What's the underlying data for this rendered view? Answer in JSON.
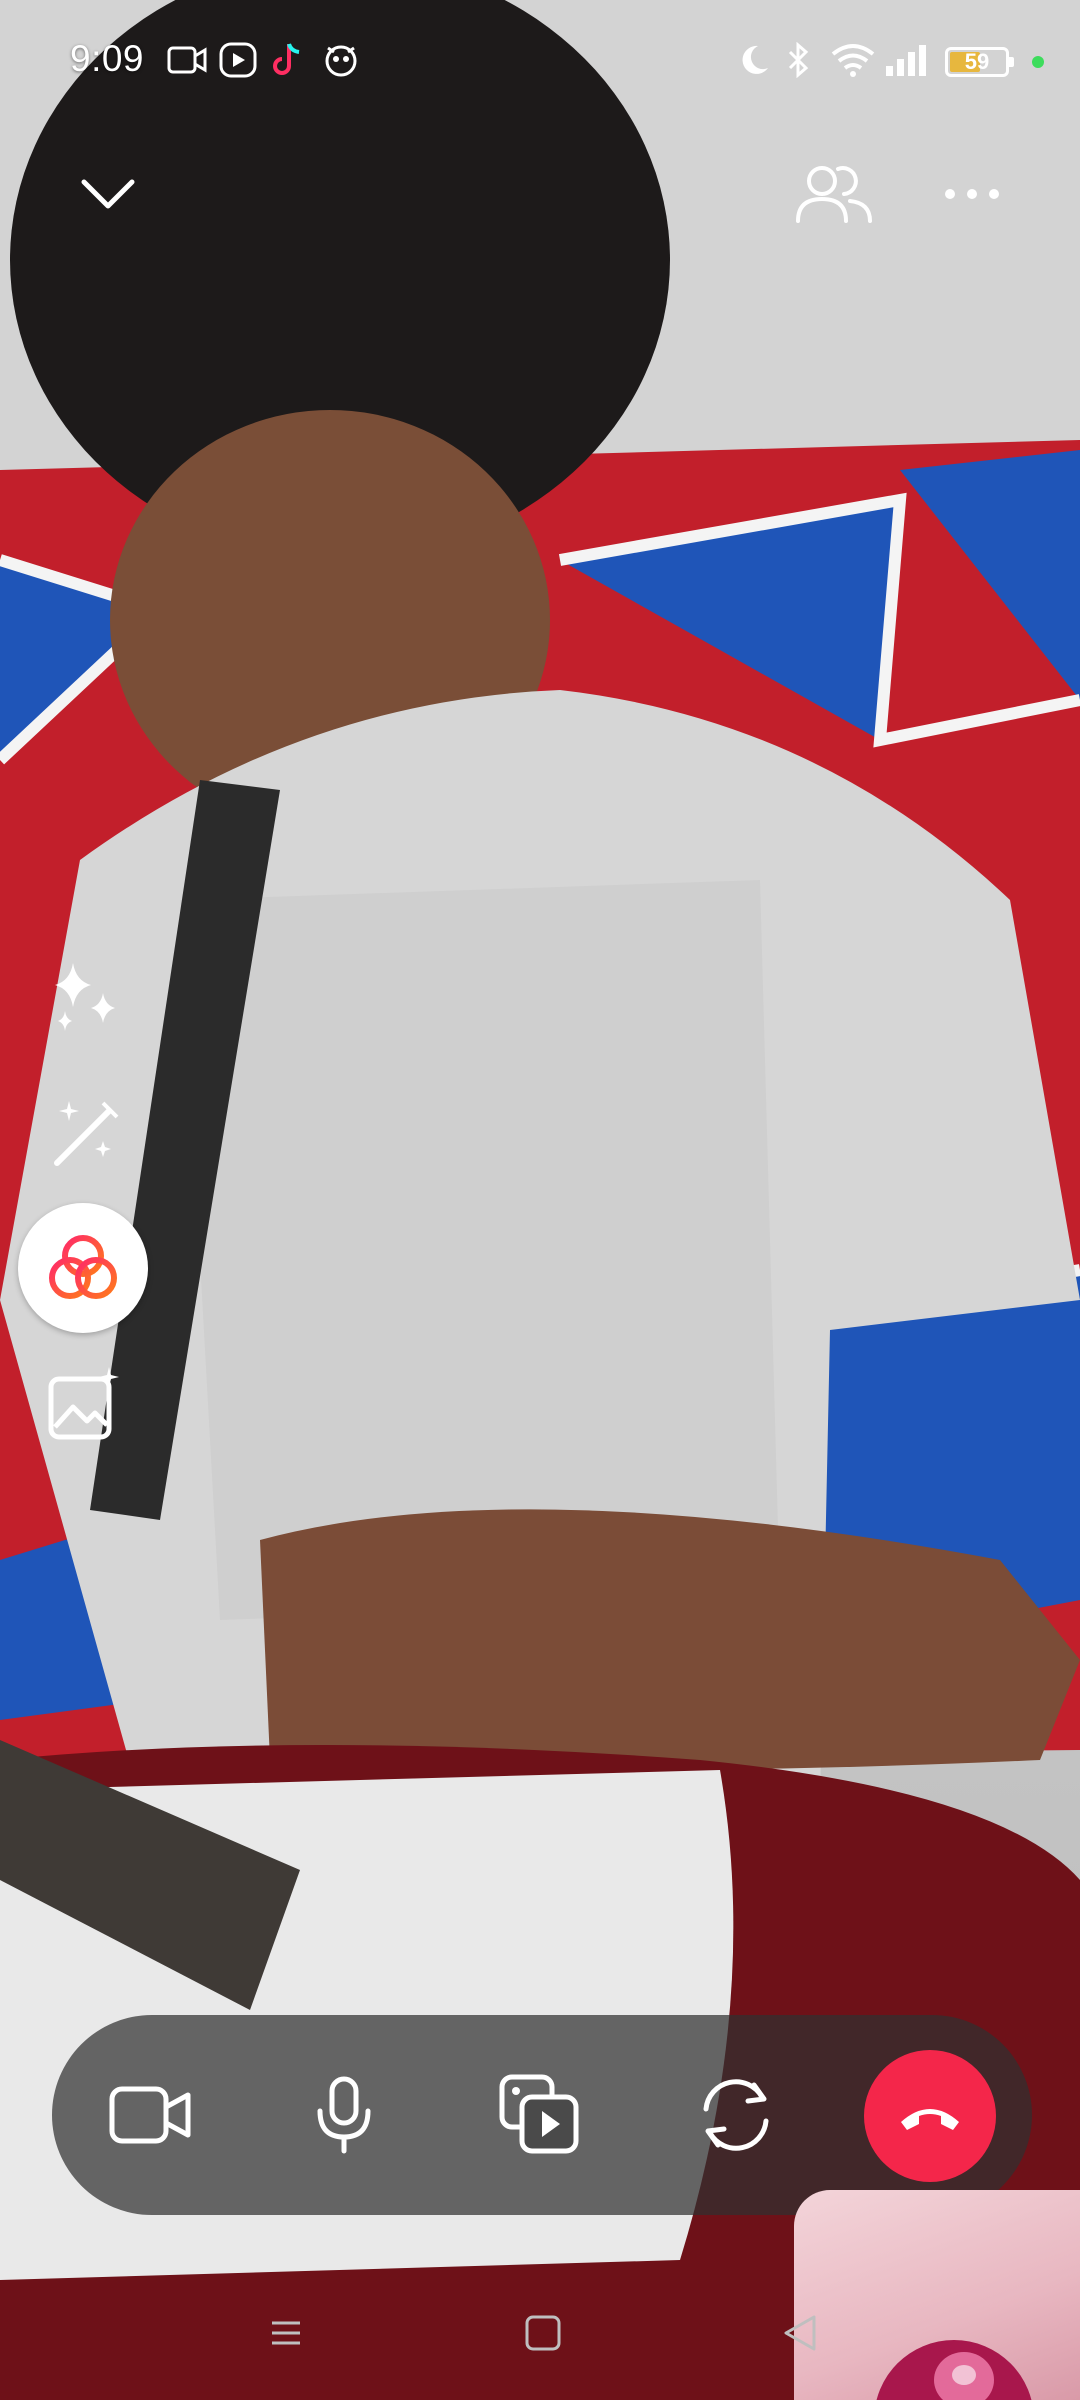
{
  "status_bar": {
    "time": "9:09",
    "battery": "59",
    "battery_level": 0.59,
    "icons": [
      "video-record-icon",
      "media-icon",
      "tiktok-icon",
      "app-icon",
      "moon-icon",
      "bluetooth-icon",
      "wifi-icon",
      "signal-icon",
      "battery-icon"
    ]
  },
  "call_header": {
    "icons": [
      "chevron-down-icon",
      "participants-icon",
      "more-icon"
    ]
  },
  "effects_rail": {
    "icons": [
      "sparkles-icon",
      "magic-wand-icon",
      "effects-rings-icon",
      "image-effects-icon"
    ]
  },
  "controls": {
    "icons": [
      "camera-icon",
      "microphone-icon",
      "media-share-icon",
      "flip-camera-icon",
      "end-call-icon"
    ],
    "end_call_color": "#f4264a"
  },
  "nav_bar": {
    "icons": [
      "menu-icon",
      "home-icon",
      "back-icon"
    ]
  }
}
